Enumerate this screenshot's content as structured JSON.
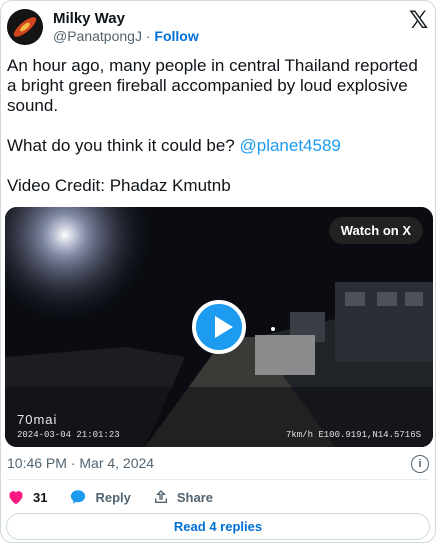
{
  "author": {
    "name": "Milky Way",
    "handle": "@PanatpongJ",
    "separator": "·",
    "follow_label": "Follow"
  },
  "post": {
    "line1": "An hour ago, many people in central Thailand reported a bright green fireball accompanied by loud explosive sound.",
    "line2_prefix": "What do you think it could be?",
    "line2_mention": "@planet4589",
    "line3": "Video Credit: Phadaz Kmutnb"
  },
  "video": {
    "watch_label": "Watch on X",
    "brand": "70mai",
    "timestamp": "2024-03-04  21:01:23",
    "coords": "7km/h  E100.9191,N14.5716S"
  },
  "meta": {
    "time": "10:46 PM · Mar 4, 2024",
    "info_icon": "info-icon"
  },
  "actions": {
    "like_count": "31",
    "reply_label": "Reply",
    "share_label": "Share"
  },
  "read_replies_label": "Read 4 replies",
  "colors": {
    "accent": "#1d9bf0",
    "link": "#006fd6",
    "like": "#f91880"
  }
}
